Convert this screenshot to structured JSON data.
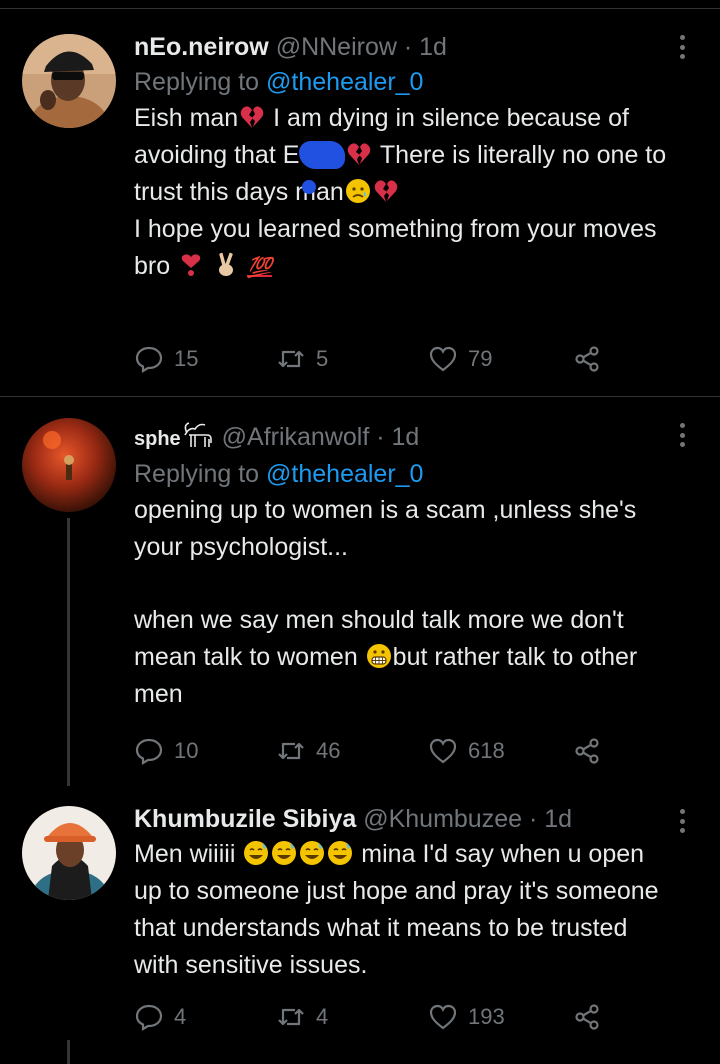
{
  "tweets": [
    {
      "name": "nEo.neirow",
      "handle": "@NNeirow",
      "time": "· 1d",
      "replying_prefix": "Replying to",
      "replying_to": "@thehealer_0",
      "text": {
        "p1_a": "Eish man",
        "p1_b": " I am dying in silence because of avoiding that E",
        "p1_c": " There is literally no one to trust this days man",
        "p2_a": "I hope you learned something from your moves bro",
        "p2_emoji": "💯"
      },
      "actions": {
        "replies": "15",
        "retweets": "5",
        "likes": "79"
      }
    },
    {
      "name": "sphe",
      "handle": "@Afrikanwolf",
      "time": "· 1d",
      "replying_prefix": "Replying to",
      "replying_to": "@thehealer_0",
      "text": {
        "p1": "opening up to women is a scam ,unless she's your psychologist...",
        "p2_a": "when we say men should talk more we don't mean talk to women ",
        "p2_b": "but rather talk to other men"
      },
      "actions": {
        "replies": "10",
        "retweets": "46",
        "likes": "618"
      }
    },
    {
      "name": "Khumbuzile Sibiya",
      "handle": "@Khumbuzee",
      "time": "· 1d",
      "text": {
        "p1_a": "Men wiiiii ",
        "p1_b": " mina I'd say when u open up to someone just hope and pray it's someone that understands what it means to be trusted with sensitive issues."
      },
      "actions": {
        "replies": "4",
        "retweets": "4",
        "likes": "193"
      }
    }
  ],
  "icons": {
    "reply": "reply-icon",
    "retweet": "retweet-icon",
    "like": "heart-icon",
    "share": "share-icon",
    "more": "more-icon"
  },
  "colors": {
    "background": "#000000",
    "text": "#e7e9ea",
    "secondary": "#71767b",
    "link": "#1d9bf0",
    "divider": "#2f3336"
  }
}
